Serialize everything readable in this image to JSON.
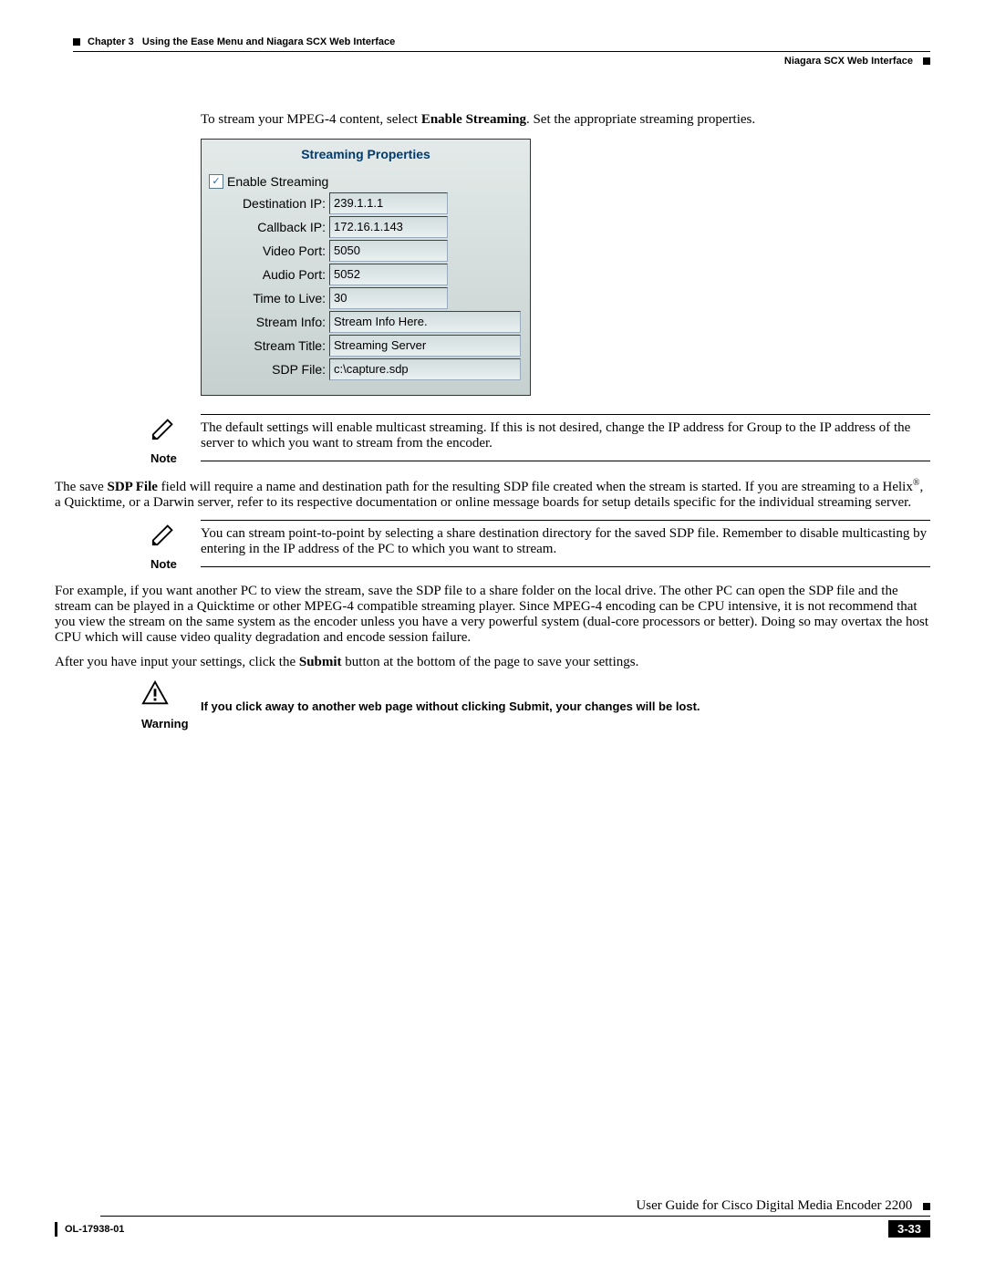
{
  "header": {
    "chapter_label": "Chapter 3",
    "chapter_title": "Using the Ease Menu and Niagara SCX Web Interface",
    "section_title": "Niagara SCX Web Interface"
  },
  "intro": {
    "pre": "To stream your MPEG-4 content, select ",
    "bold": "Enable Streaming",
    "post": ". Set the appropriate streaming properties."
  },
  "streaming_properties": {
    "title": "Streaming Properties",
    "enable_label": "Enable Streaming",
    "fields": {
      "destination_ip": {
        "label": "Destination IP:",
        "value": "239.1.1.1"
      },
      "callback_ip": {
        "label": "Callback IP:",
        "value": "172.16.1.143"
      },
      "video_port": {
        "label": "Video Port:",
        "value": "5050"
      },
      "audio_port": {
        "label": "Audio Port:",
        "value": "5052"
      },
      "ttl": {
        "label": "Time to Live:",
        "value": "30"
      },
      "stream_info": {
        "label": "Stream Info:",
        "value": "Stream Info Here."
      },
      "stream_title": {
        "label": "Stream Title:",
        "value": "Streaming Server"
      },
      "sdp_file": {
        "label": "SDP File:",
        "value": "c:\\capture.sdp"
      }
    }
  },
  "notes": {
    "note_label": "Note",
    "warning_label": "Warning",
    "note1": "The default settings will enable multicast streaming. If this is not desired, change the IP address for Group to the IP address of the server to which you want to stream from the encoder.",
    "sdp_para_pre": "The save ",
    "sdp_para_bold": "SDP File",
    "sdp_para_post": " field will require a name and destination path for the resulting SDP file created when the stream is started. If you are streaming to a Helix",
    "sdp_para_post2": ", a Quicktime, or a Darwin server, refer to its respective documentation or online message boards for setup details specific for the individual streaming server.",
    "note2": "You can stream point-to-point by selecting a share destination directory for the saved SDP file. Remember to disable multicasting by entering in the IP address of the PC to which you want to stream.",
    "example_para": "For example, if you want another PC to view the stream, save the SDP file to a share folder on the local drive. The other PC can open the SDP file and the stream can be played in a Quicktime or other MPEG-4 compatible streaming player. Since MPEG-4 encoding can be CPU intensive, it is not recommend that you view the stream on the same system as the encoder unless you have a very powerful system (dual-core processors or better). Doing so may overtax the host CPU which will cause video quality degradation and encode session failure.",
    "after_para_pre": "After you have input your settings, click the ",
    "after_para_bold": "Submit",
    "after_para_post": " button at the bottom of the page to save your settings.",
    "warning_text": "If you click away to another web page without clicking Submit, your changes will be lost."
  },
  "footer": {
    "guide_title": "User Guide for Cisco Digital Media Encoder 2200",
    "doc_id": "OL-17938-01",
    "page_number": "3-33"
  }
}
